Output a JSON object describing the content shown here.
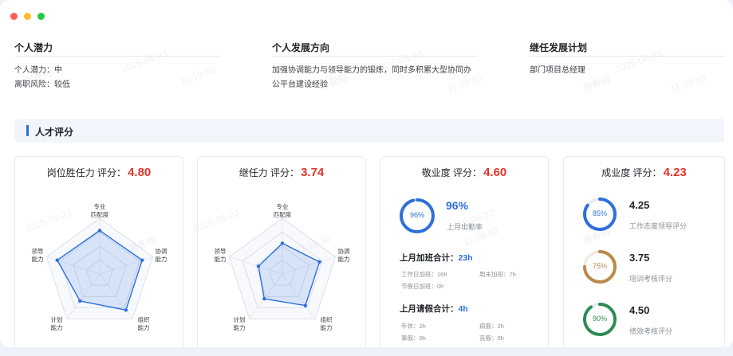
{
  "window_controls": {
    "close": "#ff5f57",
    "minimize": "#febc2e",
    "maximize": "#28c840"
  },
  "top_sections": [
    {
      "title": "个人潜力",
      "lines": [
        "个人潜力：中",
        "离职风险：较低"
      ]
    },
    {
      "title": "个人发展方向",
      "lines": [
        "加强协调能力与领导能力的锻炼，同时多积累大型协同办",
        "公平台建设经验"
      ]
    },
    {
      "title": "继任发展计划",
      "lines": [
        "部门项目总经理"
      ]
    }
  ],
  "talent_section": {
    "title": "人才评分"
  },
  "cards": {
    "post": {
      "title": "岗位胜任力 评分：",
      "score": "4.80",
      "axes": [
        "专业\n匹配度",
        "协调\n能力",
        "组织\n能力",
        "计划\n能力",
        "领导\n能力"
      ],
      "values": [
        0.78,
        0.8,
        0.8,
        0.6,
        0.8
      ]
    },
    "succession": {
      "title": "继任力 评分：",
      "score": "3.74",
      "axes": [
        "专业\n匹配度",
        "协调\n能力",
        "组织\n能力",
        "计划\n能力",
        "领导\n能力"
      ],
      "values": [
        0.55,
        0.7,
        0.7,
        0.55,
        0.45
      ]
    },
    "dedication": {
      "title": "敬业度 评分：",
      "score": "4.60",
      "attendance": {
        "ring": "96%",
        "big": "96%",
        "label": "上月出勤率",
        "fraction": 0.96
      },
      "overtime": {
        "title": "上月加班合计：",
        "value": "23h",
        "items": [
          "工作日加班：16h",
          "周末加班：7h",
          "节假日加班：0h"
        ]
      },
      "leave": {
        "title": "上月请假合计：",
        "value": "4h",
        "items": [
          "年休：2h",
          "病假：2h",
          "事假：0h",
          "丧假：0h"
        ]
      }
    },
    "achievement": {
      "title": "成业度 评分：",
      "score": "4.23",
      "rings": [
        {
          "ring": "85%",
          "value": "4.25",
          "label": "工作态度领导评分",
          "fraction": 0.85,
          "color": "#2f6fdc"
        },
        {
          "ring": "75%",
          "value": "3.75",
          "label": "培训考核评分",
          "fraction": 0.75,
          "color": "#b98a4a"
        },
        {
          "ring": "90%",
          "value": "4.50",
          "label": "绩效考核评分",
          "fraction": 0.9,
          "color": "#2e8b57"
        }
      ]
    }
  },
  "watermark": {
    "name": "谢春梅",
    "date": "2025-06-23",
    "time": "11:19:50"
  },
  "colors": {
    "accent": "#2f6fdc",
    "score": "#e0352b",
    "radar_fill": "#dde7fb",
    "radar_line": "#2f6fdc"
  }
}
